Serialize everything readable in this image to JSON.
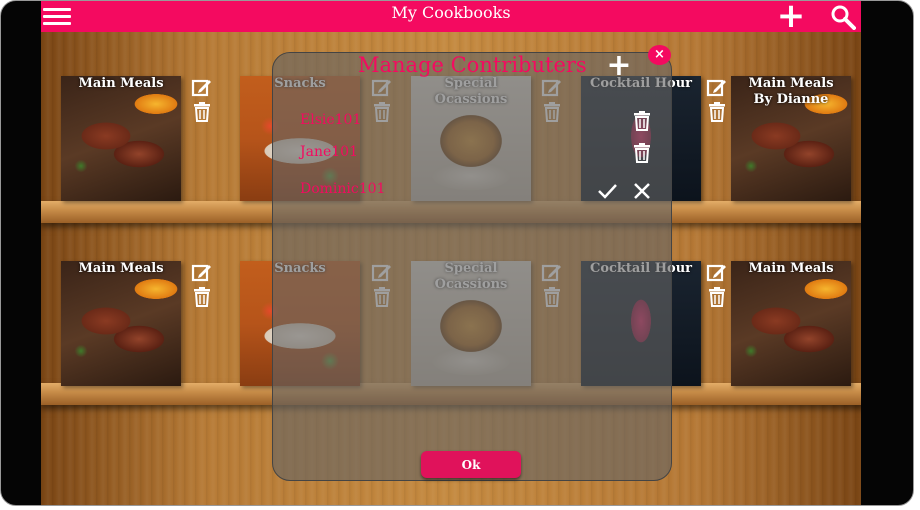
{
  "app": {
    "title": "My Cookbooks"
  },
  "shelves": [
    {
      "books": [
        {
          "title": "Main Meals",
          "image": "steak"
        },
        {
          "title": "Snacks",
          "image": "snacks"
        },
        {
          "title": "Special Ocassions",
          "image": "chicken"
        },
        {
          "title": "Cocktail Hour",
          "image": "cocktail"
        },
        {
          "title": "Main Meals By Dianne",
          "image": "steak"
        }
      ]
    },
    {
      "books": [
        {
          "title": "Main Meals",
          "image": "steak"
        },
        {
          "title": "Snacks",
          "image": "snacks"
        },
        {
          "title": "Special Ocassions",
          "image": "chicken"
        },
        {
          "title": "Cocktail Hour",
          "image": "cocktail"
        },
        {
          "title": "Main Meals",
          "image": "steak"
        }
      ]
    }
  ],
  "modal": {
    "title": "Manage Contributers",
    "close_label": "×",
    "add_label": "+",
    "contributors": [
      {
        "name": "Elsie101",
        "status": "accepted"
      },
      {
        "name": "Jane101",
        "status": "accepted"
      },
      {
        "name": "Dominic101",
        "status": "pending"
      }
    ],
    "ok_label": "Ok"
  },
  "icons": {
    "menu": "menu-icon",
    "add": "add-icon",
    "search": "search-icon",
    "edit": "edit-icon",
    "delete": "trash-icon",
    "accept": "check-icon",
    "reject": "close-icon"
  },
  "colors": {
    "accent": "#f40a60",
    "topbar": "#f40a60"
  }
}
